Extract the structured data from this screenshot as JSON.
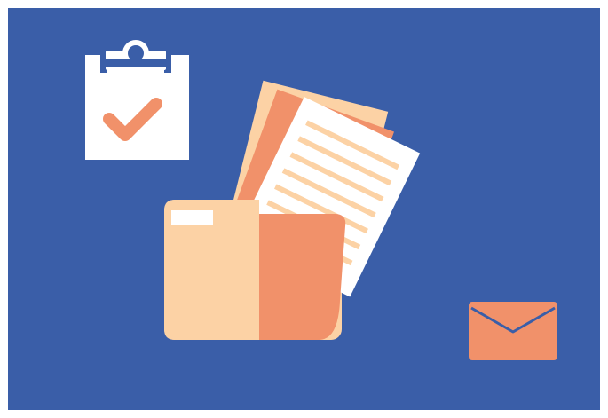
{
  "illustration": {
    "icons": [
      "clipboard-check-icon",
      "folder-documents-icon",
      "envelope-icon"
    ]
  },
  "colors": {
    "panel_background": "#3a5ea8",
    "outer_border": "#ffffff",
    "clipboard_paper": "#ffffff",
    "clipboard_clip": "#3a5ea8",
    "checkmark": "#f1916a",
    "folder_back": "#fcd2a5",
    "folder_front": "#f1916a",
    "folder_tab": "#ffffff",
    "document_paper": "#ffffff",
    "document_lines": "#fcd2a5",
    "back_sheet_light": "#fcd2a5",
    "back_sheet_dark": "#f1916a",
    "envelope_body": "#f1916a",
    "envelope_flap_line": "#3a5ea8"
  }
}
